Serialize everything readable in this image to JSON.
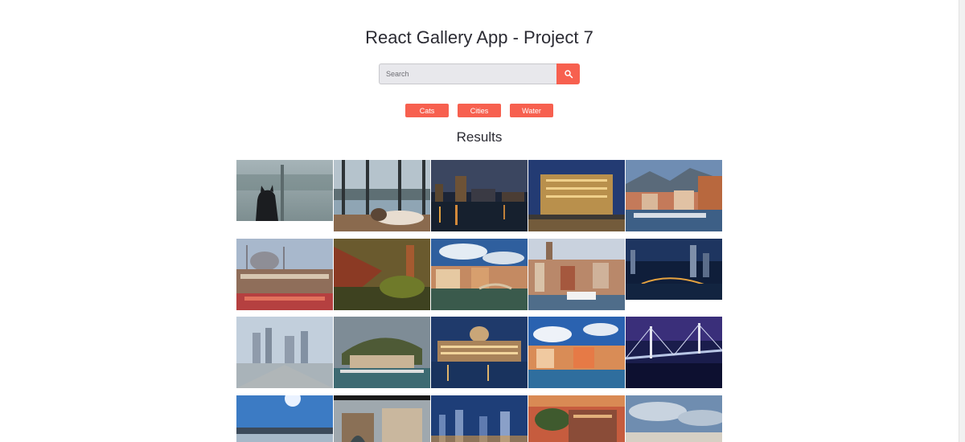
{
  "header": {
    "title": "React Gallery App - Project 7"
  },
  "search": {
    "placeholder": "Search",
    "value": ""
  },
  "icons": {
    "search": "search-icon"
  },
  "colors": {
    "accent": "#f7604f",
    "input_bg": "#e8e8ec",
    "text": "#2b2b33"
  },
  "nav": {
    "items": [
      {
        "label": "Cats"
      },
      {
        "label": "Cities"
      },
      {
        "label": "Water"
      }
    ]
  },
  "results": {
    "heading": "Results"
  }
}
